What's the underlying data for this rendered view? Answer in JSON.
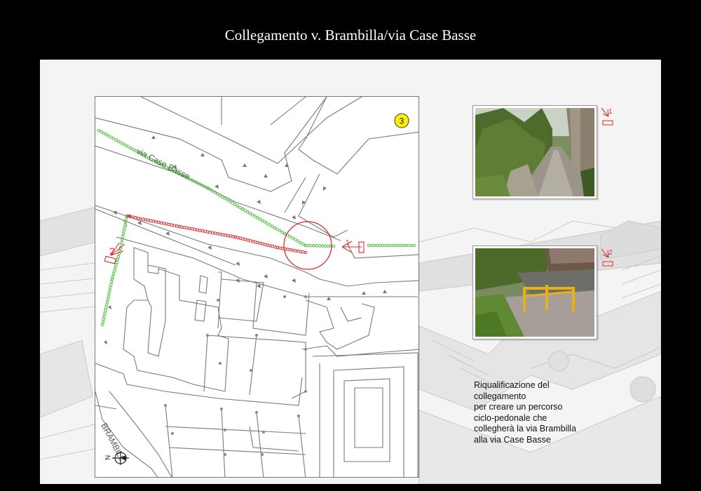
{
  "page": {
    "title": "Collegamento v. Brambilla/via Case Basse"
  },
  "map": {
    "street_case_basse": "via Case Basse",
    "street_brambilla": "BRAMBILL",
    "sheet_number": "3",
    "north_label": "N",
    "marker_1": "1",
    "marker_2": "2",
    "colors": {
      "existing_path": "#55c046",
      "proposed_path": "#d92b2b",
      "sheet_badge": "#ffee00",
      "buildings": "#7a7a7a"
    }
  },
  "photos": [
    {
      "marker": "1",
      "subject": "path-photo"
    },
    {
      "marker": "2",
      "subject": "barrier-photo"
    }
  ],
  "description": {
    "lines": [
      "Riqualificazione del",
      "collegamento",
      "per creare un percorso",
      "ciclo-pedonale che",
      "collegherà la via Brambilla",
      "alla via Case Basse"
    ]
  }
}
